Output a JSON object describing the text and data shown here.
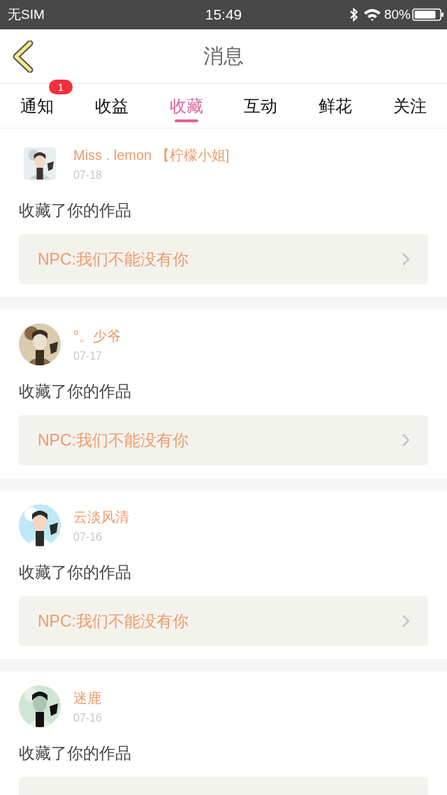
{
  "status_bar": {
    "carrier": "无SIM",
    "time": "15:49",
    "battery": "80%"
  },
  "header": {
    "title": "消息"
  },
  "tabs": [
    {
      "label": "通知",
      "selected": false,
      "badge": "1"
    },
    {
      "label": "收益",
      "selected": false
    },
    {
      "label": "收藏",
      "selected": true
    },
    {
      "label": "互动",
      "selected": false
    },
    {
      "label": "鲜花",
      "selected": false
    },
    {
      "label": "关注",
      "selected": false
    }
  ],
  "messages": [
    {
      "avatar_square": true,
      "name": "Miss . lemon 【柠檬小姐]",
      "date": "07-18",
      "text": "收藏了你的作品",
      "work": "NPC:我们不能没有你"
    },
    {
      "avatar_square": false,
      "name": "°。少爷",
      "date": "07-17",
      "text": "收藏了你的作品",
      "work": "NPC:我们不能没有你"
    },
    {
      "avatar_square": false,
      "name": "云淡风清",
      "date": "07-16",
      "text": "收藏了你的作品",
      "work": "NPC:我们不能没有你"
    },
    {
      "avatar_square": false,
      "name": "迷鹿",
      "date": "07-16",
      "text": "收藏了你的作品"
    }
  ]
}
